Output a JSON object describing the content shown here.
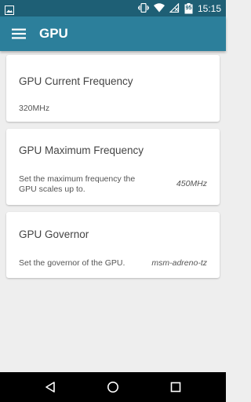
{
  "status_bar": {
    "time": "15:15",
    "battery_level": "95",
    "icons": [
      "image-icon",
      "vibrate-icon",
      "wifi-icon",
      "no-signal-icon",
      "battery-icon"
    ]
  },
  "app_bar": {
    "title": "GPU",
    "menu_icon": "hamburger-menu-icon"
  },
  "cards": {
    "current_frequency": {
      "title": "GPU Current Frequency",
      "value": "320MHz"
    },
    "max_frequency": {
      "title": "GPU Maximum Frequency",
      "description": "Set the maximum frequency the GPU scales up to.",
      "value": "450MHz"
    },
    "governor": {
      "title": "GPU Governor",
      "description": "Set the governor of the GPU.",
      "value": "msm-adreno-tz"
    }
  },
  "nav_bar": {
    "buttons": [
      "back-icon",
      "home-icon",
      "recents-icon"
    ]
  },
  "colors": {
    "status_bar": "#1e5f75",
    "app_bar": "#2c7f9b",
    "background": "#eeeeee",
    "card": "#ffffff",
    "nav_bar": "#000000"
  }
}
